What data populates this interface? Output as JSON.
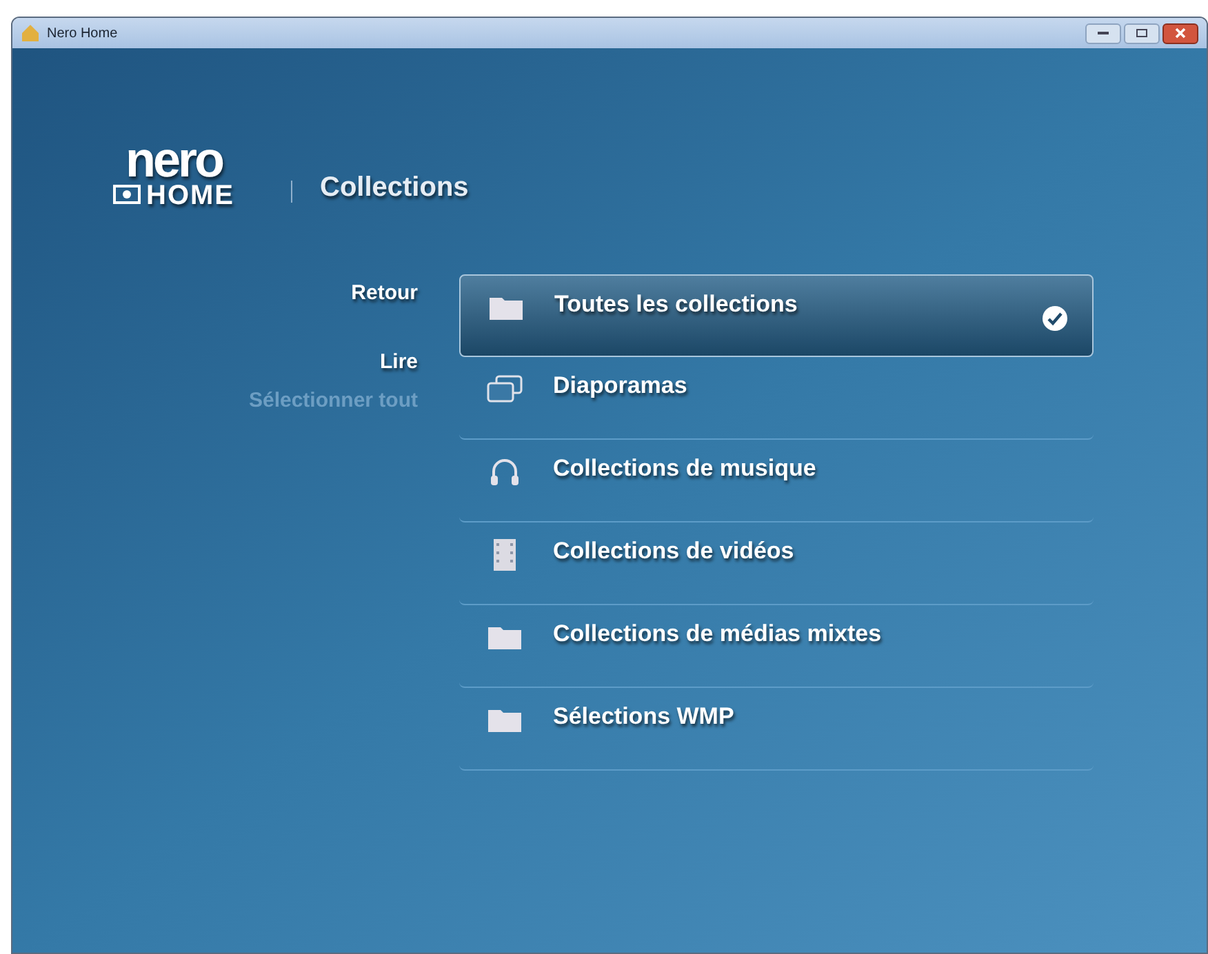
{
  "window": {
    "title": "Nero Home"
  },
  "logo": {
    "brand": "nero",
    "product": "HOME"
  },
  "header": {
    "title": "Collections"
  },
  "menu": [
    {
      "label": "Retour",
      "disabled": false
    },
    {
      "label": "Lire",
      "disabled": false
    },
    {
      "label": "Sélectionner tout",
      "disabled": true
    }
  ],
  "collections": [
    {
      "label": "Toutes les collections",
      "kind": "folder",
      "selected": true,
      "checked": true
    },
    {
      "label": "Diaporamas",
      "kind": "slides",
      "selected": false,
      "checked": false
    },
    {
      "label": "Collections de musique",
      "kind": "music",
      "selected": false,
      "checked": false
    },
    {
      "label": "Collections de vidéos",
      "kind": "video",
      "selected": false,
      "checked": false
    },
    {
      "label": "Collections de médias mixtes",
      "kind": "folder",
      "selected": false,
      "checked": false
    },
    {
      "label": "Sélections WMP",
      "kind": "folder",
      "selected": false,
      "checked": false
    }
  ]
}
